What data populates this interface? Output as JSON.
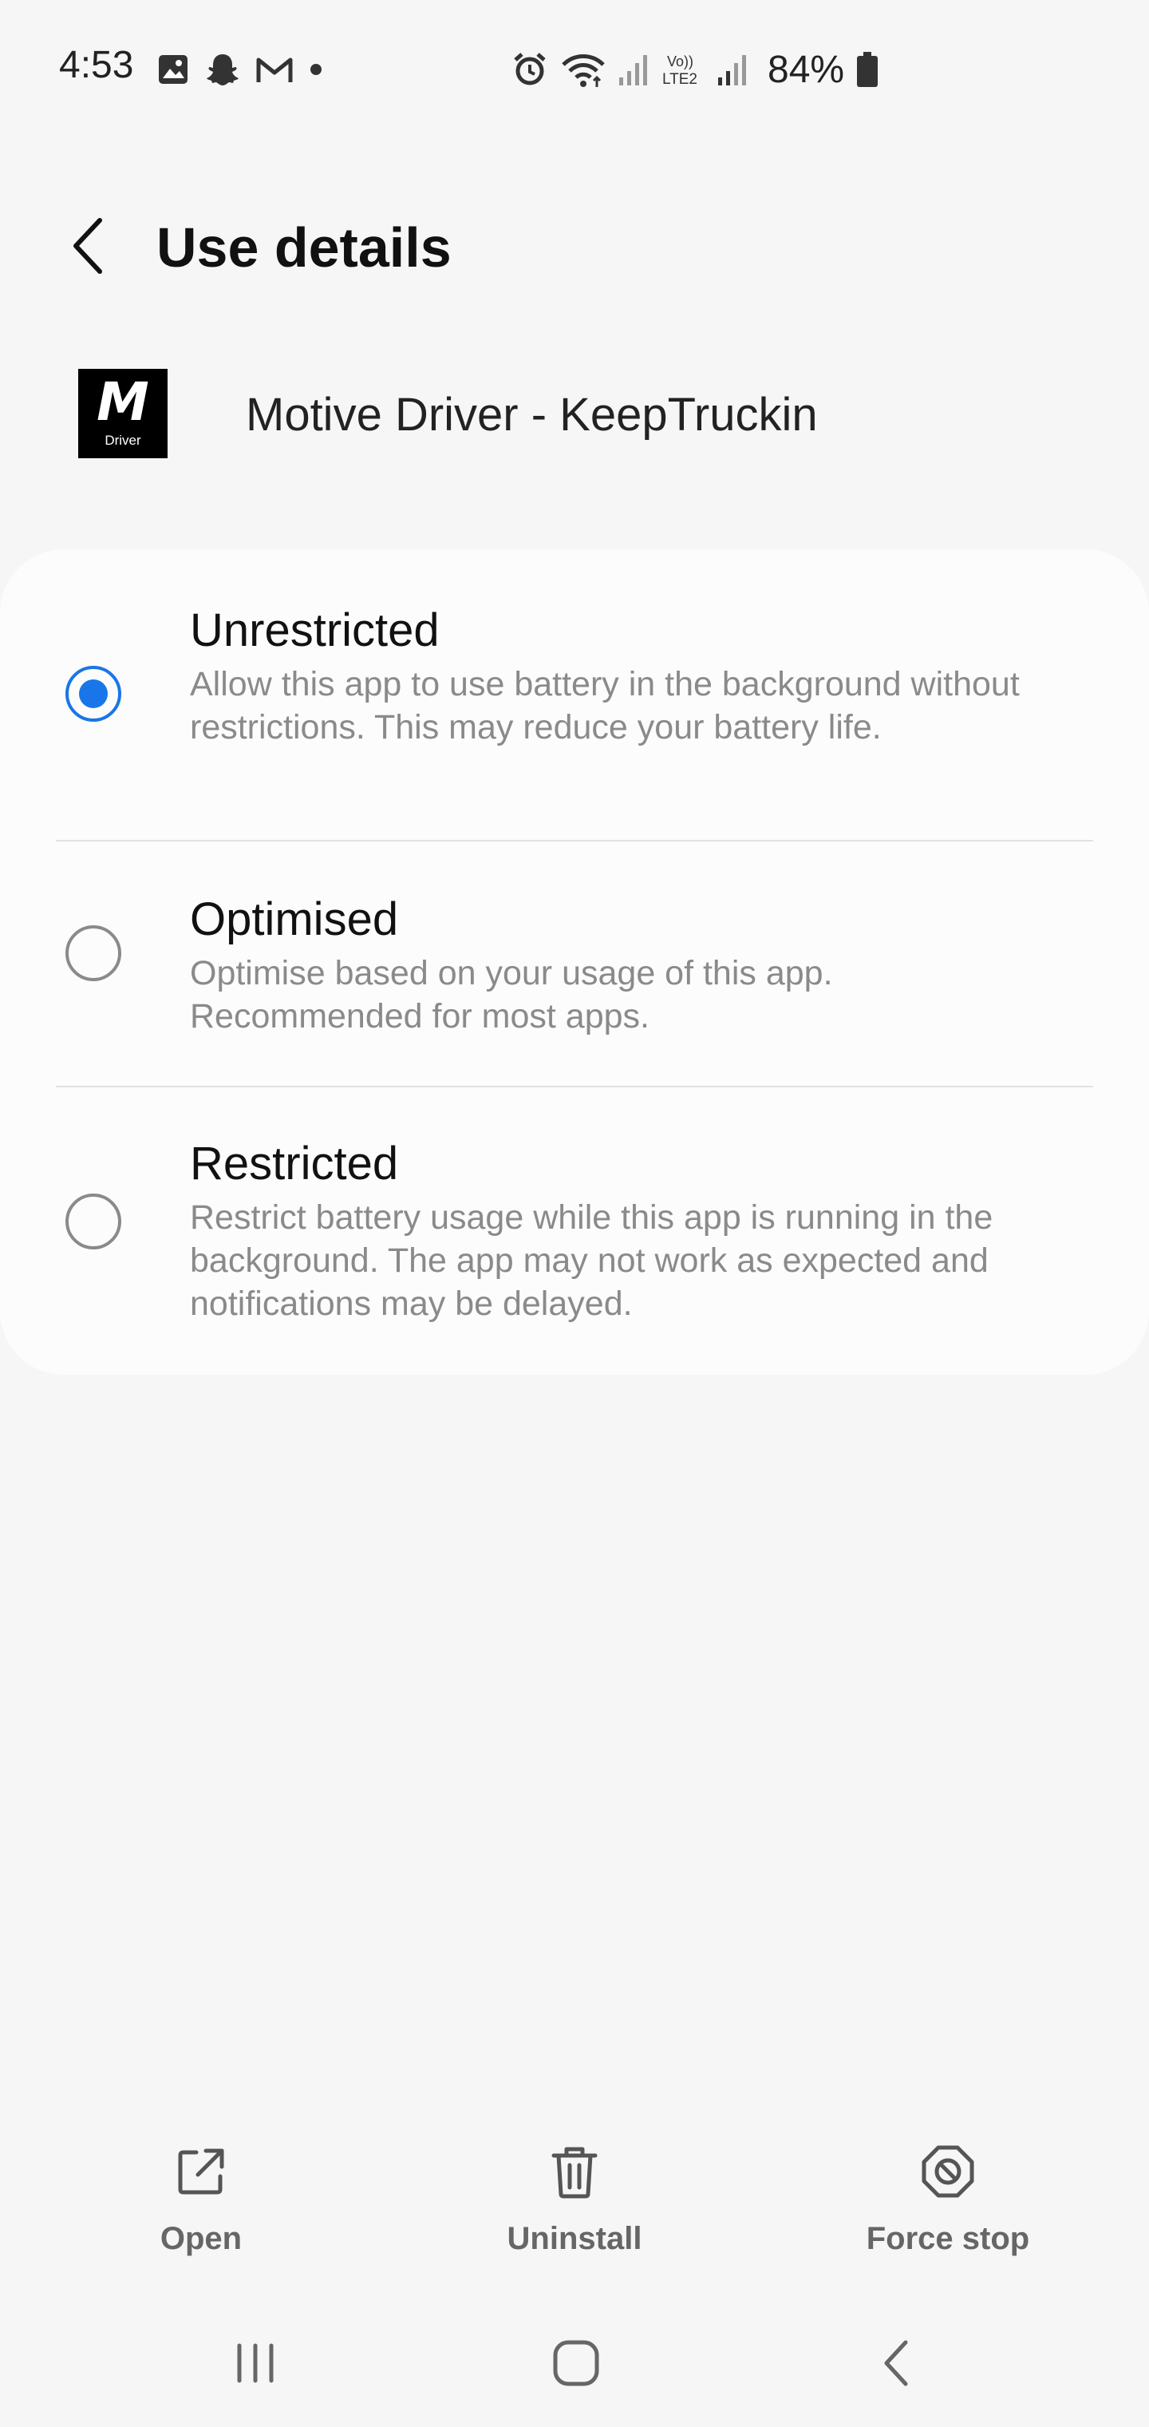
{
  "status_bar": {
    "time": "4:53",
    "battery": "84%",
    "left_icons": [
      "gallery-icon",
      "snapchat-icon",
      "gmail-icon",
      "dot-icon"
    ],
    "right_icons": [
      "alarm-icon",
      "wifi-icon",
      "signal-icon",
      "volte-lte2-icon",
      "signal-icon",
      "battery-icon"
    ]
  },
  "header": {
    "title": "Use details",
    "back_icon": "chevron-left-icon"
  },
  "app": {
    "icon_letter": "M",
    "icon_sub": "Driver",
    "name": "Motive Driver - KeepTruckin"
  },
  "options": [
    {
      "title": "Unrestricted",
      "description": "Allow this app to use battery in the background without restrictions. This may reduce your battery life.",
      "selected": true
    },
    {
      "title": "Optimised",
      "description": "Optimise based on your usage of this app. Recommended for most apps.",
      "selected": false
    },
    {
      "title": "Restricted",
      "description": "Restrict battery usage while this app is running in the background. The app may not work as expected and notifications may be delayed.",
      "selected": false
    }
  ],
  "actions": {
    "open": "Open",
    "uninstall": "Uninstall",
    "force_stop": "Force stop"
  },
  "colors": {
    "accent": "#1976e8",
    "background": "#f6f6f6",
    "card": "#fcfcfc"
  }
}
